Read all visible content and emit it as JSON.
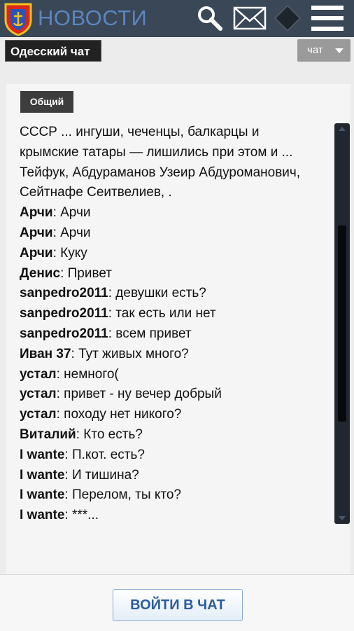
{
  "header": {
    "brand_label": "НОВОСТИ",
    "icons": [
      "city-emblem-icon",
      "search-icon",
      "mail-icon",
      "diamond-icon",
      "menu-icon"
    ],
    "background_color": "#3a4756",
    "brand_color": "#5b86bf"
  },
  "chat_title": "Одесский чат",
  "chat_select": {
    "selected": "чат"
  },
  "tab_label": "Общий",
  "messages": [
    {
      "nick": "",
      "sep": "",
      "text": "СССР ... ингуши, чеченцы, балкарцы и"
    },
    {
      "nick": "",
      "sep": "",
      "text": "крымские татары — лишились при этом и ..."
    },
    {
      "nick": "",
      "sep": "",
      "text": "Тейфук, Абдураманов Узеир Абдуроманович,"
    },
    {
      "nick": "",
      "sep": "",
      "text": "Сейтнафе Сеитвелиев, ."
    },
    {
      "nick": "Арчи",
      "sep": ":",
      "text": " Арчи"
    },
    {
      "nick": "Арчи",
      "sep": ":",
      "text": " Арчи"
    },
    {
      "nick": "Арчи",
      "sep": ":",
      "text": " Куку"
    },
    {
      "nick": "Денис",
      "sep": ":",
      "text": " Привет"
    },
    {
      "nick": "sanpedro2011",
      "sep": ":",
      "text": " девушки есть?"
    },
    {
      "nick": "sanpedro2011",
      "sep": ":",
      "text": " так есть или нет"
    },
    {
      "nick": "sanpedro2011",
      "sep": ":",
      "text": " всем привет"
    },
    {
      "nick": "Иван 37",
      "sep": ":",
      "text": " Тут живых много?"
    },
    {
      "nick": "устал",
      "sep": ":",
      "text": " немного("
    },
    {
      "nick": "устал",
      "sep": ":",
      "text": " привет - ну вечер добрый"
    },
    {
      "nick": "устал",
      "sep": ":",
      "text": " походу нет никого?"
    },
    {
      "nick": "Виталий",
      "sep": ":",
      "text": " Кто есть?"
    },
    {
      "nick": "I wante",
      "sep": ":",
      "text": " П.кот. есть?"
    },
    {
      "nick": "I wante",
      "sep": ":",
      "text": " И тишина?"
    },
    {
      "nick": "I wante",
      "sep": ":",
      "text": " Перелом, ты кто?"
    },
    {
      "nick": "I wante",
      "sep": ":",
      "text": " ***..."
    }
  ],
  "scroll_position_fraction": 0.5,
  "enter_button_label": "ВОЙТИ В ЧАТ",
  "accent_color": "#2a5c9c"
}
